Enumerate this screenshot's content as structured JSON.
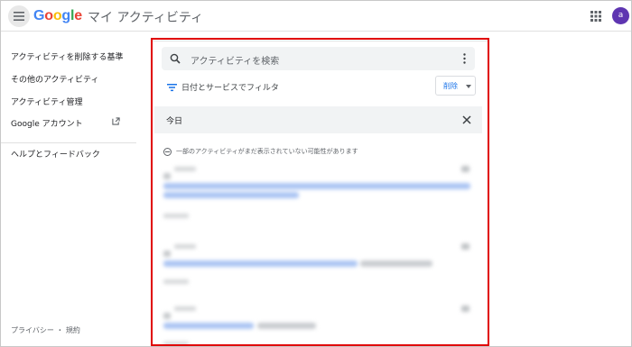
{
  "header": {
    "logo": [
      "G",
      "o",
      "o",
      "g",
      "l",
      "e"
    ],
    "title": "マイ アクティビティ",
    "avatar_initial": "a"
  },
  "sidebar": {
    "items": [
      {
        "label": "アクティビティを削除する基準",
        "icon": ""
      },
      {
        "label": "その他のアクティビティ",
        "icon": ""
      },
      {
        "label": "アクティビティ管理",
        "icon": ""
      },
      {
        "label": "Google アカウント",
        "icon": "open-in-new-icon"
      },
      {
        "label": "ヘルプとフィードバック",
        "icon": ""
      }
    ],
    "footer": "プライバシー ・ 規約"
  },
  "main": {
    "search_placeholder": "アクティビティを検索",
    "filter_label": "日付とサービスでフィルタ",
    "delete_label": "削除",
    "section_title": "今日",
    "notice": "一部のアクティビティがまだ表示されていない可能性があります"
  },
  "colors": {
    "accent": "#1a73e8",
    "highlight_border": "#e00000",
    "avatar": "#5e35b1"
  }
}
